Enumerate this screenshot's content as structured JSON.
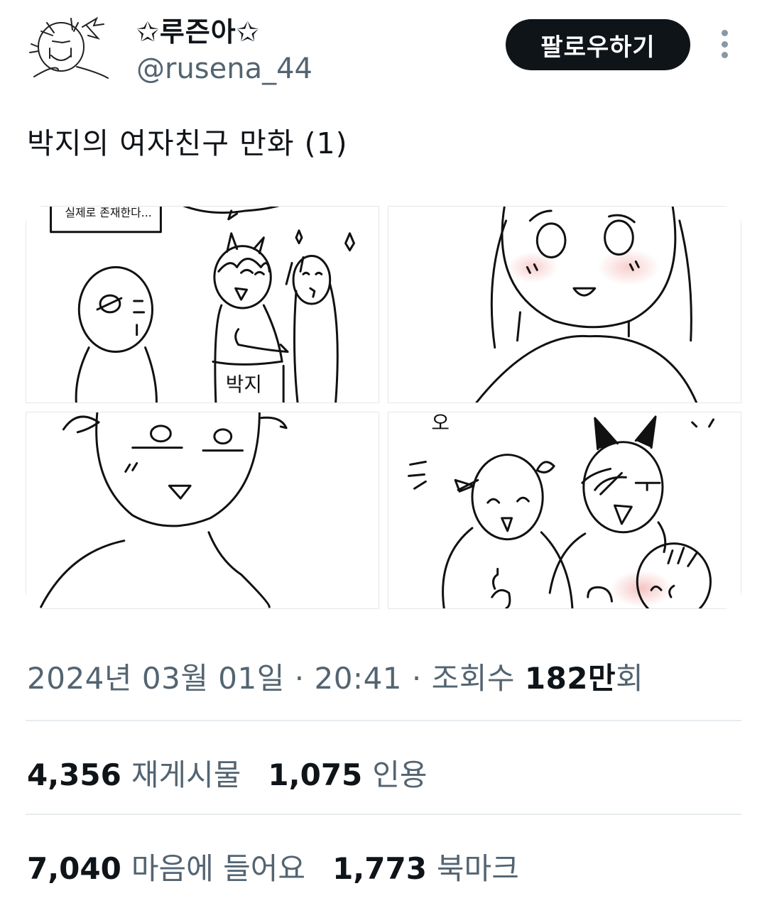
{
  "user": {
    "display_name": "✩루즌아✩",
    "handle": "@rusena_44"
  },
  "header": {
    "follow_label": "팔로우하기",
    "more_icon": "more-vertical-icon"
  },
  "tweet": {
    "text": "박지의 여자친구 만화 (1)"
  },
  "media": {
    "panel1_caption": "실제로 존재한다...",
    "panel1_label": "박지",
    "panel4_text": "오"
  },
  "meta": {
    "date": "2024년 03월 01일",
    "sep1": " · ",
    "time": "20:41",
    "sep2": " · ",
    "views_label": "조회수 ",
    "views_count": "182만",
    "views_suffix": "회"
  },
  "stats": {
    "retweets": {
      "count": "4,356",
      "label": "재게시물"
    },
    "quotes": {
      "count": "1,075",
      "label": "인용"
    },
    "likes": {
      "count": "7,040",
      "label": "마음에 들어요"
    },
    "bookmarks": {
      "count": "1,773",
      "label": "북마크"
    }
  }
}
